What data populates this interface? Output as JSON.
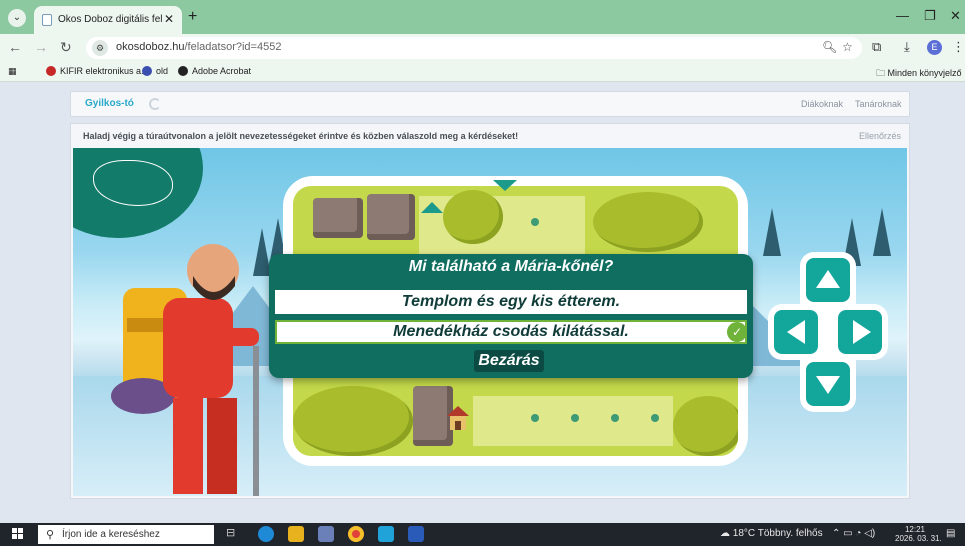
{
  "browser": {
    "tab_title": "Okos Doboz digitális feladatgyű",
    "new_tab_label": "+",
    "url_host": "okosdoboz.hu",
    "url_path": "/feladatsor?id=4552",
    "bookmarks": [
      {
        "label": "KIFIR elektronikus a...",
        "color": "#c62828"
      },
      {
        "label": "old",
        "color": "#3a4fb0"
      },
      {
        "label": "Adobe Acrobat",
        "color": "#222222"
      }
    ],
    "all_bookmarks_label": "Minden könyvjelző",
    "profile_initial": "E"
  },
  "site": {
    "title": "Gyilkos-tó",
    "nav_students": "Diákoknak",
    "nav_teachers": "Tanároknak"
  },
  "task": {
    "instruction": "Haladj végig a túraútvonalon a jelölt nevezetességeket érintve és közben válaszold meg a kérdéseket!",
    "check_label": "Ellenőrzés"
  },
  "quiz": {
    "question": "Mi található a Mária-kőnél?",
    "answers": [
      {
        "text": "Templom és egy kis étterem.",
        "selected": false
      },
      {
        "text": "Menedékház csodás kilátással.",
        "selected": true
      }
    ],
    "close_label": "Bezárás"
  },
  "taskbar": {
    "search_placeholder": "Írjon ide a kereséshez",
    "weather": "18°C  Többny. felhős",
    "time": "12:21",
    "date": "2026. 03. 31."
  },
  "colors": {
    "quiz_bg": "#106e60",
    "accent_teal": "#13a79c",
    "correct_green": "#6fb33a",
    "site_title": "#2aa8c9"
  }
}
